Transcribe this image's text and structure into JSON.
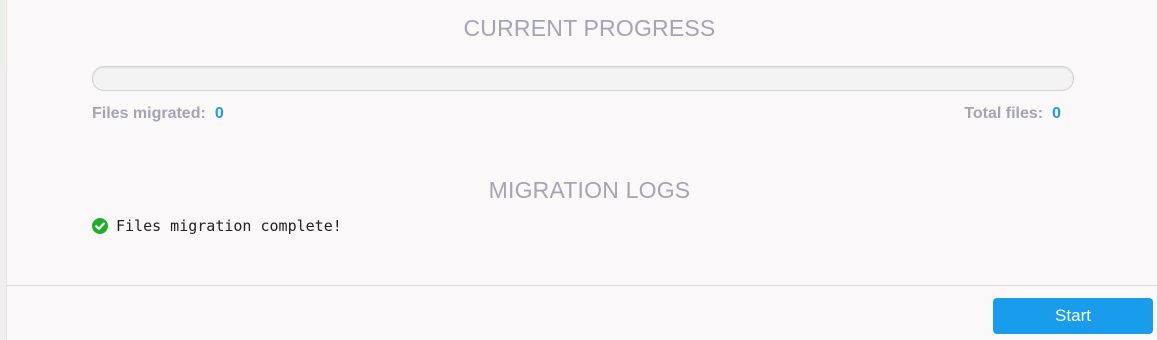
{
  "progress": {
    "title": "CURRENT PROGRESS",
    "percent": 0,
    "files_migrated_label": "Files migrated:",
    "files_migrated_value": "0",
    "total_files_label": "Total files:",
    "total_files_value": "0"
  },
  "logs": {
    "title": "MIGRATION LOGS",
    "entries": [
      {
        "icon": "check-circle-icon",
        "text": "Files migration complete!"
      }
    ]
  },
  "footer": {
    "start_label": "Start"
  },
  "colors": {
    "accent": "#1a9cec",
    "muted_text": "#a5a4b6",
    "success": "#1fae2e"
  }
}
